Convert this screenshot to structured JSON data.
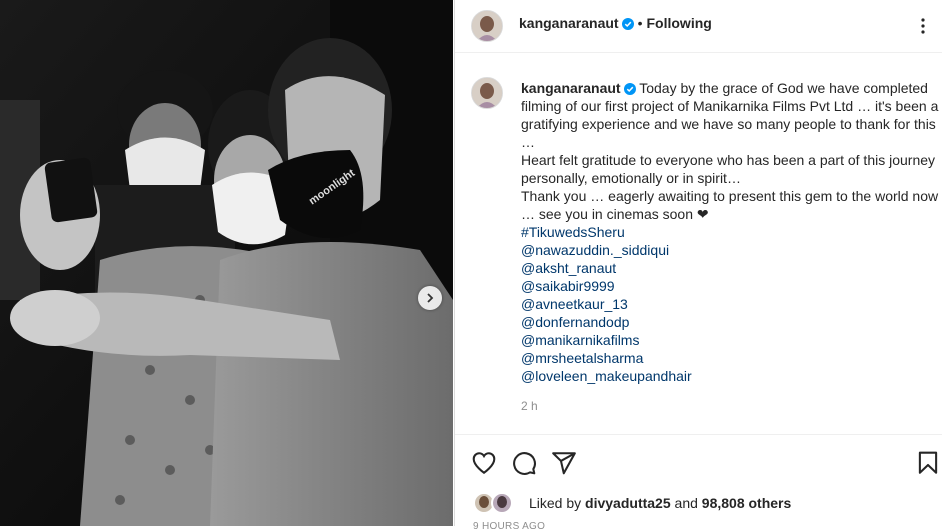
{
  "post": {
    "username": "kanganaranaut",
    "follow_label": "Following",
    "separator": "•",
    "caption_first": "Today by the grace of God we have completed",
    "caption_lines": [
      "filming of our first project of Manikarnika Films Pvt Ltd … it's been a",
      "gratifying experience and we have so many people to thank for this",
      "…",
      "Heart felt gratitude to everyone who has been a part of this journey",
      "personally, emotionally or in spirit…",
      "Thank you … eagerly awaiting to present this gem to the world now",
      "… see you in cinemas soon ❤"
    ],
    "tags": [
      "#TikuwedsSheru",
      "@nawazuddin._siddiqui",
      "@aksht_ranaut",
      "@saikabir9999",
      "@avneetkaur_13",
      "@donfernandodp",
      "@manikarnikafilms",
      "@mrsheetalsharma",
      "@loveleen_makeupandhair"
    ],
    "time": "2 h",
    "likes_prefix": "Liked by",
    "liked_by_user": "divyadutta25",
    "likes_and": "and",
    "likes_count": "98,808 others",
    "posted_ago": "9 HOURS AGO",
    "mask_text": "moonlight"
  },
  "colors": {
    "link": "#00376b",
    "verified": "#0095f6",
    "muted": "#8e8e8e",
    "border": "#dbdbdb"
  }
}
